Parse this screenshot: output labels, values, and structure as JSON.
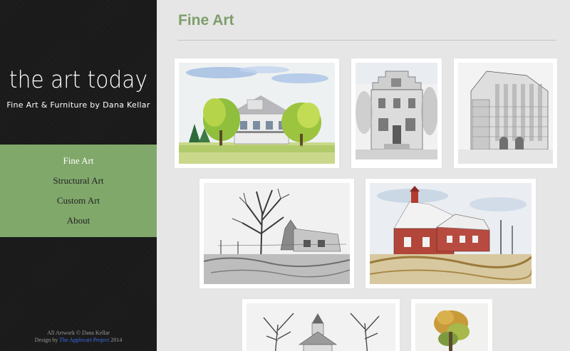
{
  "site": {
    "title": "the art today",
    "tagline": "Fine Art & Furniture by Dana Kellar"
  },
  "nav": {
    "items": [
      {
        "label": "Fine Art",
        "active": true
      },
      {
        "label": "Structural Art",
        "active": false
      },
      {
        "label": "Custom Art",
        "active": false
      },
      {
        "label": "About",
        "active": false
      }
    ]
  },
  "footer": {
    "line1": "All Artwork © Dana Kellar",
    "line2_prefix": "Design by",
    "link": "The Applecart Project",
    "year": "2014"
  },
  "page": {
    "title": "Fine Art"
  },
  "colors": {
    "accent_green": "#80a86b",
    "title_green": "#7d9e6a",
    "sidebar_bg": "#1c1c1c",
    "link_blue": "#3b6df0"
  },
  "gallery": [
    {
      "subject": "watercolor-farmhouse-with-trees"
    },
    {
      "subject": "pencil-stepped-gable-building"
    },
    {
      "subject": "pencil-corner-city-building"
    },
    {
      "subject": "pencil-bare-tree-and-shack"
    },
    {
      "subject": "watercolor-red-barn"
    },
    {
      "subject": "pencil-church-steeple-with-trees"
    },
    {
      "subject": "watercolor-autumn-tree"
    }
  ]
}
